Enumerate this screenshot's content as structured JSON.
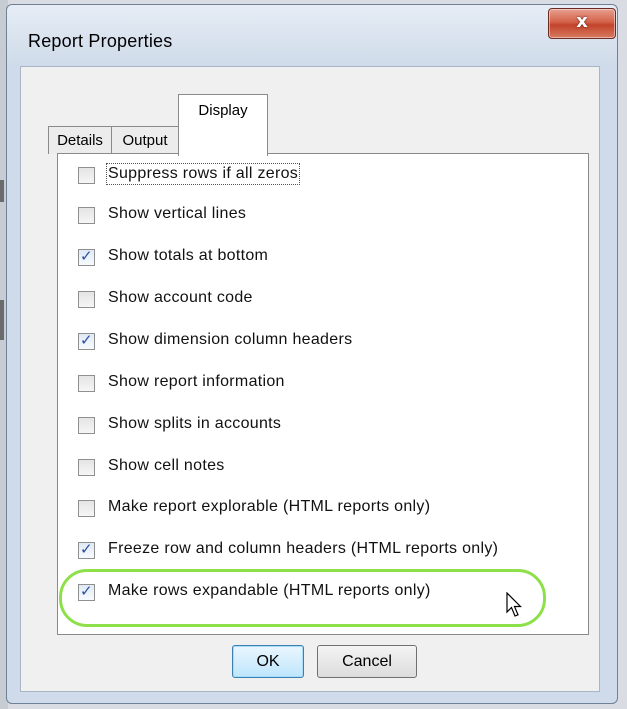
{
  "dialog": {
    "title": "Report Properties",
    "close_glyph": "x"
  },
  "tabs": [
    {
      "label": "Details",
      "active": false
    },
    {
      "label": "Output",
      "active": false
    },
    {
      "label": "Display",
      "active": true
    }
  ],
  "options": [
    {
      "label": "Suppress rows if all zeros",
      "checked": false
    },
    {
      "label": "Show vertical lines",
      "checked": false
    },
    {
      "label": "Show totals at bottom",
      "checked": true
    },
    {
      "label": "Show account code",
      "checked": false
    },
    {
      "label": "Show dimension column headers",
      "checked": true
    },
    {
      "label": "Show report information",
      "checked": false
    },
    {
      "label": "Show splits in accounts",
      "checked": false
    },
    {
      "label": "Show cell notes",
      "checked": false
    },
    {
      "label": "Make report explorable (HTML reports only)",
      "checked": false
    },
    {
      "label": "Freeze row and column headers (HTML reports only)",
      "checked": true
    },
    {
      "label": "Make rows expandable (HTML reports only)",
      "checked": true
    }
  ],
  "buttons": {
    "ok_label": "OK",
    "cancel_label": "Cancel"
  },
  "colors": {
    "highlight": "#8de04a",
    "checkmark": "#2b4f9b",
    "close_button": "#c2432b"
  }
}
